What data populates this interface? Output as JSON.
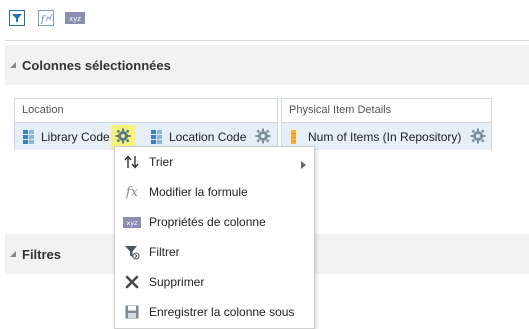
{
  "toolbar": {
    "buttons": [
      {
        "name": "filter-toggle-button",
        "icon": "filter-icon"
      },
      {
        "name": "formula-button",
        "icon": "formula-icon"
      },
      {
        "name": "column-properties-button",
        "icon": "xyz-icon",
        "text": "xyz"
      }
    ]
  },
  "sections": {
    "selected_columns": {
      "title": "Colonnes sélectionnées"
    },
    "filters": {
      "title": "Filtres"
    }
  },
  "column_groups": [
    {
      "label": "Location",
      "columns": [
        {
          "label": "Library Code",
          "icon": "attribute-column-icon",
          "gear_active": true
        },
        {
          "label": "Location Code",
          "icon": "attribute-column-icon",
          "gear_active": false
        }
      ]
    },
    {
      "label": "Physical Item Details",
      "columns": [
        {
          "label": "Num of Items (In Repository)",
          "icon": "measure-column-icon",
          "gear_active": false
        }
      ]
    }
  ],
  "context_menu": {
    "items": [
      {
        "label": "Trier",
        "icon": "sort-icon",
        "has_submenu": true
      },
      {
        "label": "Modifier la formule",
        "icon": "fx-icon",
        "has_submenu": false
      },
      {
        "label": "Propriétés de colonne",
        "icon": "xyz-icon",
        "icon_text": "xyz",
        "has_submenu": false
      },
      {
        "label": "Filtrer",
        "icon": "filter-icon",
        "has_submenu": false
      },
      {
        "label": "Supprimer",
        "icon": "delete-x-icon",
        "has_submenu": false
      },
      {
        "label": "Enregistrer la colonne sous",
        "icon": "save-icon",
        "has_submenu": false
      }
    ],
    "fx_glyph": "fx"
  },
  "colors": {
    "accent_blue": "#1f6fb8",
    "gear_highlight": "#f6f27a",
    "column_bg": "#e6eef7",
    "section_bg": "#f2f2f2"
  }
}
